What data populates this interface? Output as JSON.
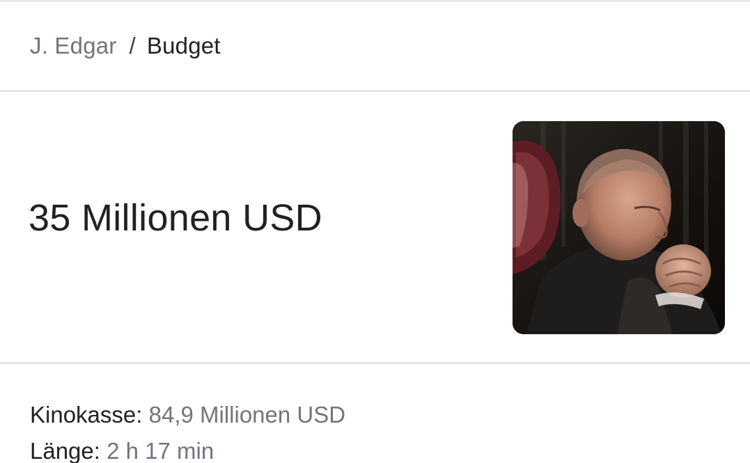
{
  "breadcrumb": {
    "parent": "J. Edgar",
    "separator": "/",
    "current": "Budget"
  },
  "answer": {
    "value": "35 Millionen USD"
  },
  "thumbnail": {
    "icon": "person-photo",
    "description_hidden": true
  },
  "facts": [
    {
      "label": "Kinokasse:",
      "value": "84,9 Millionen USD"
    },
    {
      "label": "Länge:",
      "value": "2 h 17 min"
    }
  ],
  "colors": {
    "primary_text": "#202124",
    "secondary_text": "#70757a",
    "divider": "#e3e3e3"
  }
}
